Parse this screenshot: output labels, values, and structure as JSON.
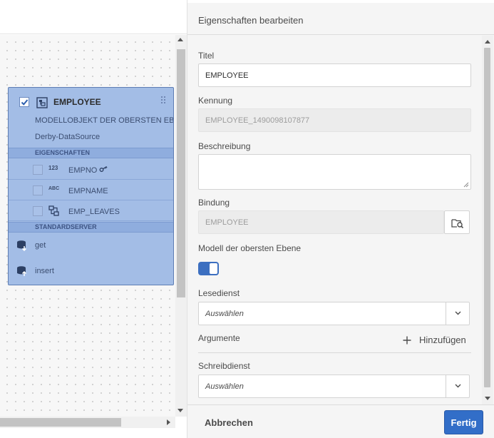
{
  "canvas": {
    "model": {
      "title": "EMPLOYEE",
      "description": "MODELLOBJEKT DER OBERSTEN EBENE",
      "datasource": "Derby-DataSource",
      "properties_header": "EIGENSCHAFTEN",
      "properties": [
        {
          "type": "123",
          "name": "EMPNO",
          "icon": "key-icon"
        },
        {
          "type": "ABC",
          "name": "EMPNAME"
        },
        {
          "type": "",
          "name": "EMP_LEAVES",
          "icon": "entity-icon"
        }
      ],
      "services_header": "STANDARDSERVER",
      "services": [
        {
          "name": "get",
          "icon": "database-get-icon"
        },
        {
          "name": "insert",
          "icon": "database-insert-icon"
        }
      ]
    },
    "colors": {
      "card_fill": "#a3bde6",
      "card_border": "#5e7db3"
    }
  },
  "panel": {
    "title": "Eigenschaften bearbeiten",
    "titel_label": "Titel",
    "titel_value": "EMPLOYEE",
    "kennung_label": "Kennung",
    "kennung_value": "EMPLOYEE_1490098107877",
    "beschreibung_label": "Beschreibung",
    "beschreibung_value": "",
    "bindung_label": "Bindung",
    "bindung_value": "EMPLOYEE",
    "toplevel_label": "Modell der obersten Ebene",
    "toplevel_on": true,
    "lesedienst_label": "Lesedienst",
    "lesedienst_value": "Auswählen",
    "argumente_label": "Argumente",
    "add_label": "Hinzufügen",
    "schreibdienst_label": "Schreibdienst",
    "schreibdienst_value": "Auswählen"
  },
  "footer": {
    "cancel_label": "Abbrechen",
    "done_label": "Fertig",
    "accent_color": "#326ec8"
  }
}
